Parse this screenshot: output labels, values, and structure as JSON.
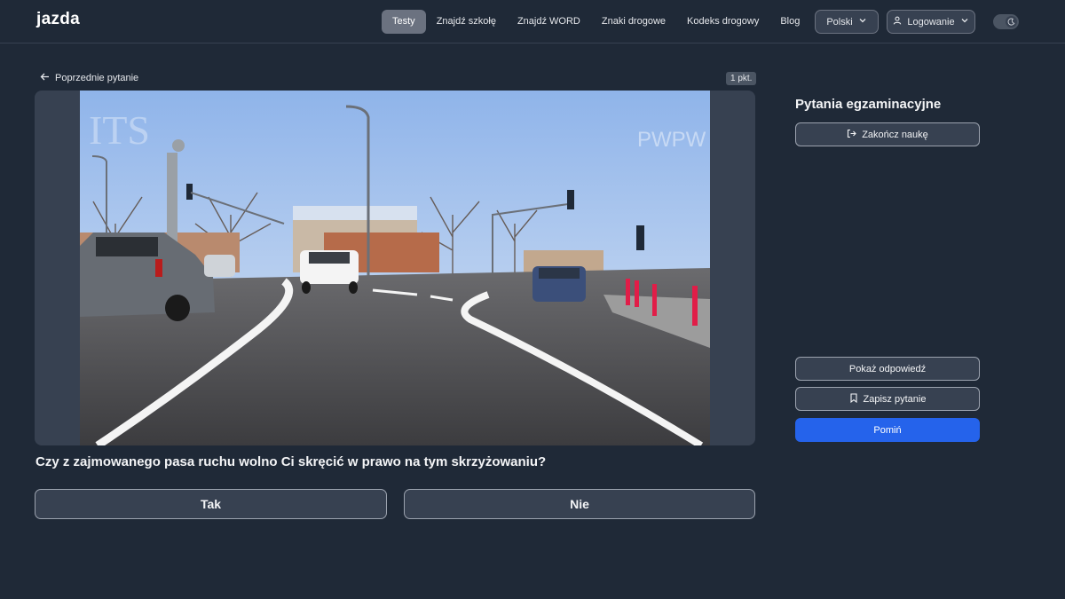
{
  "header": {
    "logo": "jazda",
    "nav": [
      {
        "label": "Testy",
        "active": true
      },
      {
        "label": "Znajdź szkołę",
        "active": false
      },
      {
        "label": "Znajdź WORD",
        "active": false
      },
      {
        "label": "Znaki drogowe",
        "active": false
      },
      {
        "label": "Kodeks drogowy",
        "active": false
      },
      {
        "label": "Blog",
        "active": false
      }
    ],
    "language": "Polski",
    "login": "Logowanie"
  },
  "question": {
    "back_label": "Poprzednie pytanie",
    "points": "1 pkt.",
    "text": "Czy z zajmowanego pasa ruchu wolno Ci skręcić w prawo na tym skrzyżowaniu?",
    "answers": [
      "Tak",
      "Nie"
    ],
    "image_watermark_left": "ITS",
    "image_watermark_right": "PWPW"
  },
  "sidebar": {
    "title": "Pytania egzaminacyjne",
    "end_label": "Zakończ naukę",
    "show_answer_label": "Pokaż odpowiedź",
    "save_label": "Zapisz pytanie",
    "skip_label": "Pomiń"
  },
  "colors": {
    "background": "#1f2937",
    "primary": "#2563eb",
    "button_bg": "#374151"
  }
}
